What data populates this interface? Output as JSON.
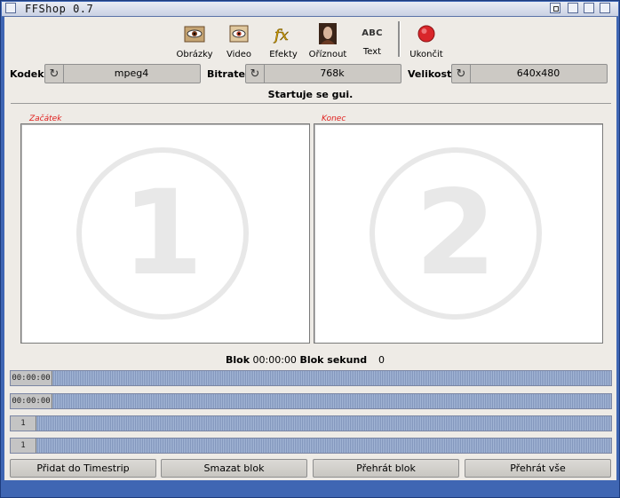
{
  "window": {
    "title": "FFShop 0.7"
  },
  "toolbar": {
    "items": [
      {
        "label": "Obrázky",
        "icon": "images-icon"
      },
      {
        "label": "Video",
        "icon": "video-icon"
      },
      {
        "label": "Efekty",
        "icon": "effects-icon"
      },
      {
        "label": "Oříznout",
        "icon": "crop-icon"
      },
      {
        "label": "Text",
        "icon": "text-icon",
        "glyph": "ABC"
      },
      {
        "label": "Ukončit",
        "icon": "quit-icon"
      }
    ]
  },
  "settings": {
    "kodek": {
      "label": "Kodek",
      "value": "mpeg4"
    },
    "bitrate": {
      "label": "Bitrate",
      "value": "768k"
    },
    "velikost": {
      "label": "Velikost",
      "value": "640x480"
    }
  },
  "status": "Startuje se gui.",
  "frames": {
    "start": {
      "title": "Začátek",
      "number": "1"
    },
    "end": {
      "title": "Konec",
      "number": "2"
    }
  },
  "blok": {
    "label": "Blok",
    "time": "00:00:00",
    "seconds_label": "Blok sekund",
    "seconds": "0"
  },
  "timeline": {
    "bars": [
      {
        "knob": "00:00:00"
      },
      {
        "knob": "00:00:00"
      },
      {
        "knob": "1"
      },
      {
        "knob": "1"
      }
    ]
  },
  "buttons": {
    "add": "Přidat do Timestrip",
    "delete": "Smazat blok",
    "play_block": "Přehrát blok",
    "play_all": "Přehrát vše"
  },
  "colors": {
    "frame_title": "#e0201e",
    "timeline_bar": "#a3b6d6",
    "window_frame": "#3f66b3"
  }
}
